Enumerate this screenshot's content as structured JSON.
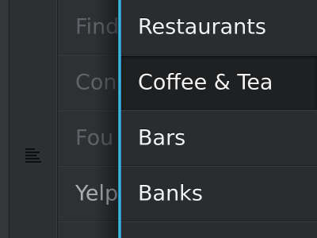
{
  "toolbar": {
    "icon": "list-icon"
  },
  "background_list": {
    "items": [
      {
        "label": "Find"
      },
      {
        "label": "Con"
      },
      {
        "label": "Fou"
      },
      {
        "label": "Yelp"
      }
    ]
  },
  "drawer": {
    "accent_color": "#3bb4e6",
    "categories": [
      {
        "label": "Restaurants",
        "selected": false
      },
      {
        "label": "Coffee & Tea",
        "selected": true
      },
      {
        "label": "Bars",
        "selected": false
      },
      {
        "label": "Banks",
        "selected": false
      }
    ]
  }
}
